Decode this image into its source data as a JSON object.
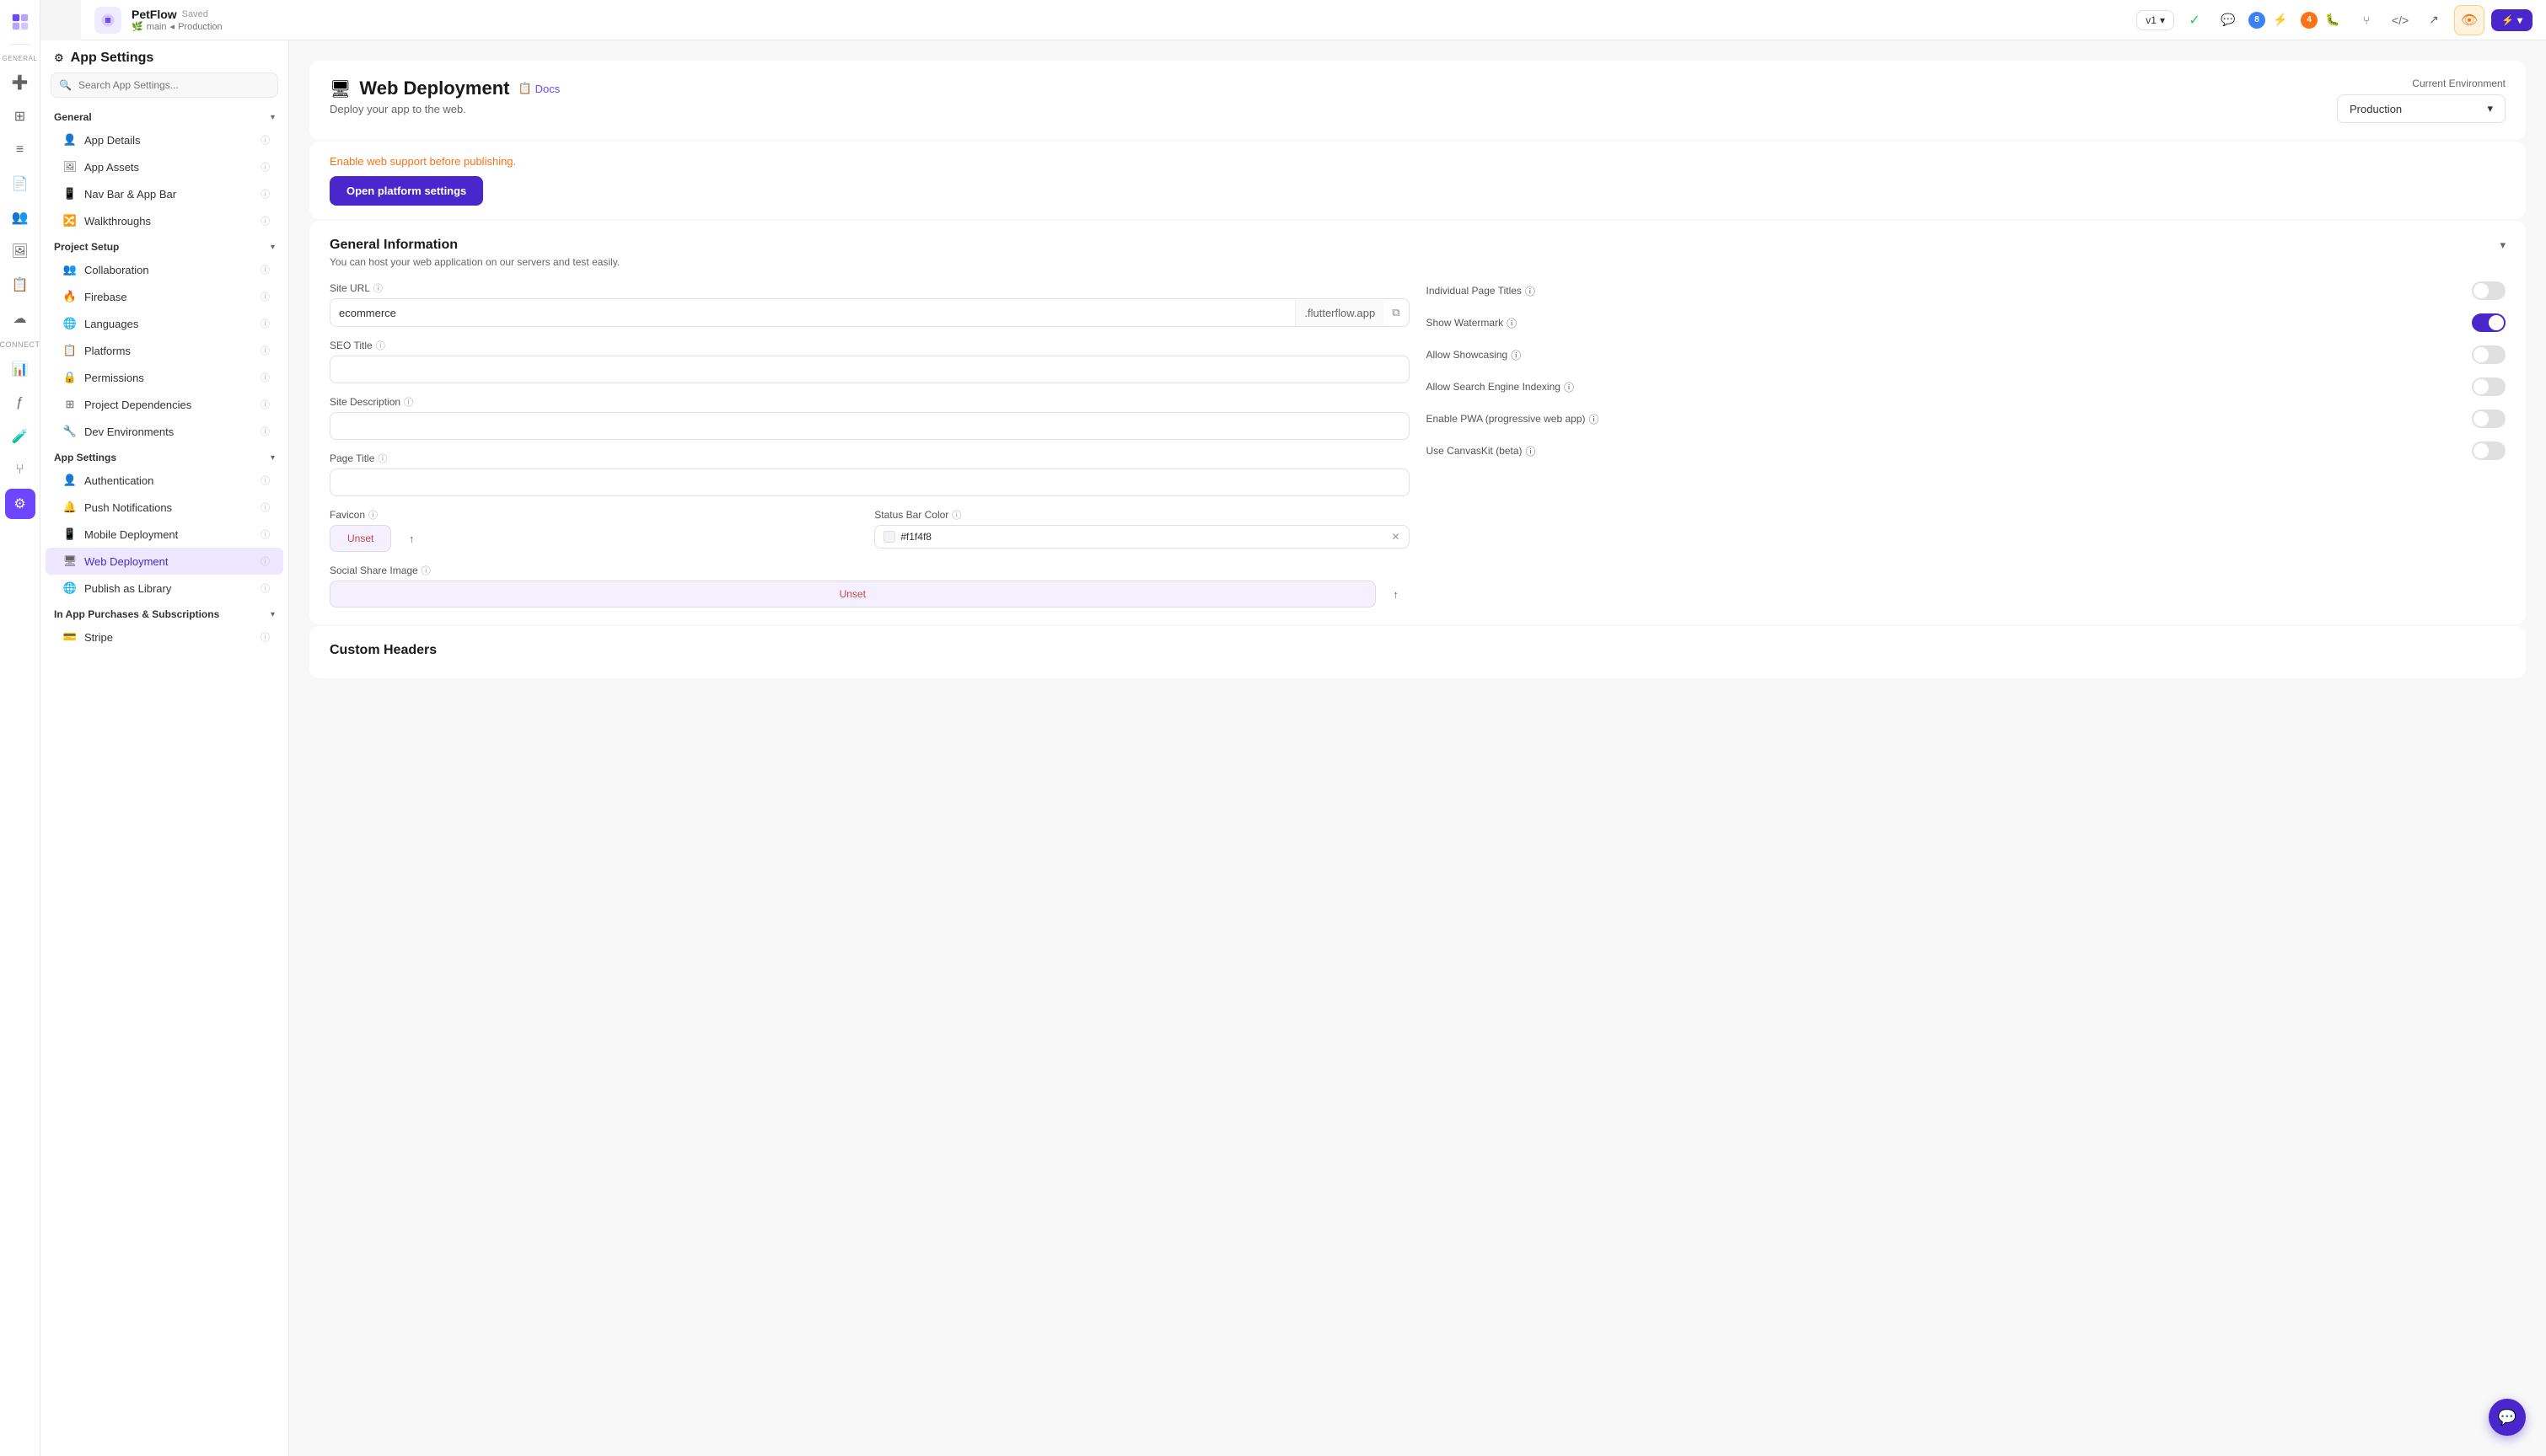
{
  "app": {
    "name": "PetFlow",
    "status": "Saved",
    "branch_icon": "🌿",
    "branch": "main",
    "env_branch": "Production"
  },
  "topbar": {
    "version": "v1",
    "help_icon": "?",
    "search_icon": "🔍",
    "badge_blue_count": "8",
    "badge_orange_count": "4",
    "eye_icon": "👁",
    "lightning_label": "▶"
  },
  "sidebar": {
    "title": "App Settings",
    "search_placeholder": "Search App Settings...",
    "sections": [
      {
        "label": "General",
        "items": [
          {
            "id": "app-details",
            "label": "App Details",
            "icon": "👤"
          },
          {
            "id": "app-assets",
            "label": "App Assets",
            "icon": "🖼"
          },
          {
            "id": "nav-bar",
            "label": "Nav Bar & App Bar",
            "icon": "📱"
          },
          {
            "id": "walkthroughs",
            "label": "Walkthroughs",
            "icon": "🔀"
          }
        ]
      },
      {
        "label": "Project Setup",
        "items": [
          {
            "id": "collaboration",
            "label": "Collaboration",
            "icon": "👥"
          },
          {
            "id": "firebase",
            "label": "Firebase",
            "icon": "🔥"
          },
          {
            "id": "languages",
            "label": "Languages",
            "icon": "🌐"
          },
          {
            "id": "platforms",
            "label": "Platforms",
            "icon": "📋"
          },
          {
            "id": "permissions",
            "label": "Permissions",
            "icon": "🔒"
          },
          {
            "id": "project-dependencies",
            "label": "Project Dependencies",
            "icon": "⊞"
          },
          {
            "id": "dev-environments",
            "label": "Dev Environments",
            "icon": "🔧"
          }
        ]
      },
      {
        "label": "App Settings",
        "items": [
          {
            "id": "authentication",
            "label": "Authentication",
            "icon": "👤"
          },
          {
            "id": "push-notifications",
            "label": "Push Notifications",
            "icon": "🔔"
          },
          {
            "id": "mobile-deployment",
            "label": "Mobile Deployment",
            "icon": "📱"
          },
          {
            "id": "web-deployment",
            "label": "Web Deployment",
            "icon": "🖥",
            "active": true
          },
          {
            "id": "publish-as-library",
            "label": "Publish as Library",
            "icon": "🌐"
          }
        ]
      },
      {
        "label": "In App Purchases & Subscriptions",
        "items": [
          {
            "id": "stripe",
            "label": "Stripe",
            "icon": "💳"
          }
        ]
      }
    ]
  },
  "main": {
    "title": "Web Deployment",
    "title_icon": "🖥",
    "docs_label": "Docs",
    "subtitle": "Deploy your app to the web.",
    "current_environment_label": "Current Environment",
    "environment_value": "Production",
    "warning_text": "Enable web support before publishing.",
    "open_platform_btn": "Open platform settings",
    "general_info": {
      "title": "General Information",
      "subtitle": "You can host your web application on our servers and test easily.",
      "site_url_label": "Site URL",
      "site_url_value": "ecommerce",
      "site_url_suffix": ".flutterflow.app",
      "seo_title_label": "SEO Title",
      "seo_title_value": "",
      "site_description_label": "Site Description",
      "site_description_value": "",
      "page_title_label": "Page Title",
      "page_title_value": "",
      "favicon_label": "Favicon",
      "favicon_unset": "Unset",
      "status_bar_color_label": "Status Bar Color",
      "status_bar_color_value": "#f1f4f8",
      "social_share_image_label": "Social Share Image",
      "social_share_image_unset": "Unset",
      "individual_page_titles_label": "Individual Page Titles",
      "show_watermark_label": "Show Watermark",
      "show_watermark_on": true,
      "allow_showcasing_label": "Allow Showcasing",
      "allow_search_engine_label": "Allow Search Engine Indexing",
      "enable_pwa_label": "Enable PWA (progressive web app)",
      "use_canvaskit_label": "Use CanvasKit (beta)"
    },
    "custom_headers": {
      "title": "Custom Headers"
    }
  }
}
